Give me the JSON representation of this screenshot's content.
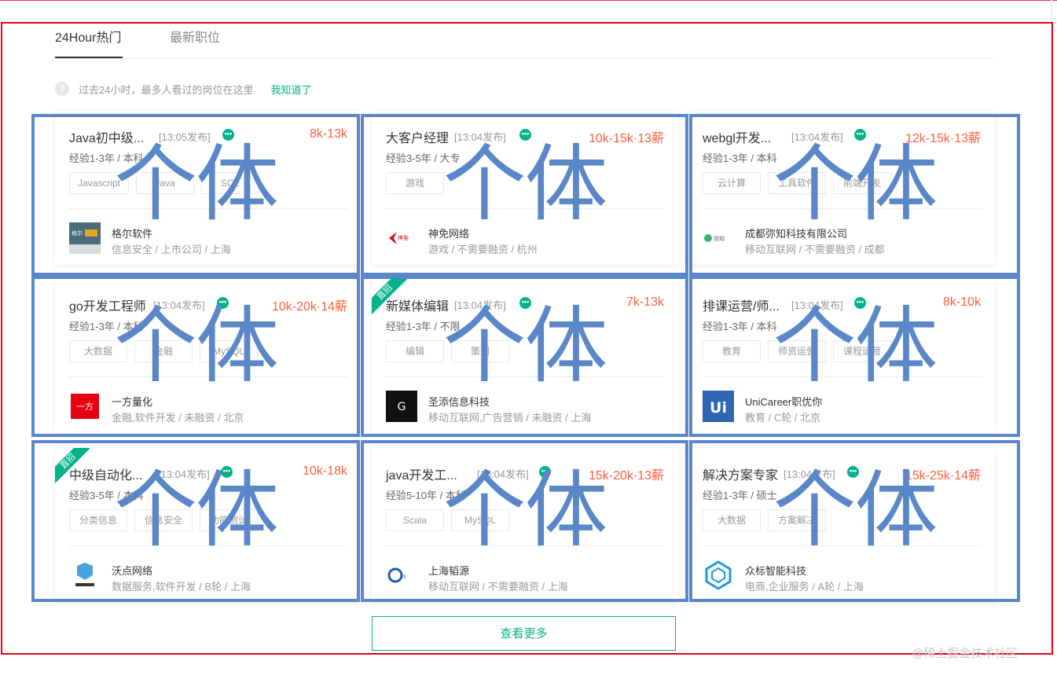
{
  "tabs": [
    {
      "label": "24Hour热门"
    },
    {
      "label": "最新职位"
    }
  ],
  "tip": {
    "icon": "question-icon",
    "text": "过去24小时，最多人看过的岗位在这里",
    "action": "我知道了"
  },
  "jobs": [
    {
      "title": "Java初中级...",
      "published": "[13:05发布]",
      "salary": "8k-13k",
      "requirements": "经验1-3年 / 本科",
      "tags": [
        "Javascript",
        "Java",
        "SQL"
      ],
      "company": "格尔软件",
      "company_info": "信息安全 / 上市公司 / 上海",
      "logo_text": "格尔软件",
      "ribbon": ""
    },
    {
      "title": "大客户经理",
      "published": "[13:04发布]",
      "salary": "10k-15k·13薪",
      "requirements": "经验3-5年 / 大专",
      "tags": [
        "游戏"
      ],
      "company": "神免网络",
      "company_info": "游戏 / 不需要融资 / 杭州",
      "logo_text": "神免网络",
      "ribbon": ""
    },
    {
      "title": "webgl开发...",
      "published": "[13:04发布]",
      "salary": "12k-15k·13薪",
      "requirements": "经验1-3年 / 本科",
      "tags": [
        "云计算",
        "工具软件",
        "前端开发"
      ],
      "company": "成都弥知科技有限公司",
      "company_info": "移动互联网 / 不需要融资 / 成都",
      "logo_text": "弥知科技",
      "ribbon": ""
    },
    {
      "title": "go开发工程师",
      "published": "[13:04发布]",
      "salary": "10k-20k·14薪",
      "requirements": "经验1-3年 / 本科",
      "tags": [
        "大数据",
        "金融",
        "MySQL"
      ],
      "company": "一方量化",
      "company_info": "金融,软件开发 / 未融资 / 北京",
      "logo_text": "一方",
      "ribbon": ""
    },
    {
      "title": "新媒体编辑",
      "published": "[13:04发布]",
      "salary": "7k-13k",
      "requirements": "经验1-3年 / 不限",
      "tags": [
        "编辑",
        "策划"
      ],
      "company": "圣添信息科技",
      "company_info": "移动互联网,广告营销 / 未融资 / 上海",
      "logo_text": "GOOD",
      "ribbon": "直招"
    },
    {
      "title": "排课运营/师...",
      "published": "[13:04发布]",
      "salary": "8k-10k",
      "requirements": "经验1-3年 / 本科",
      "tags": [
        "教育",
        "师资运营",
        "课程运营"
      ],
      "company": "UniCareer职优你",
      "company_info": "教育 / C轮 / 北京",
      "logo_text": "Ui",
      "ribbon": ""
    },
    {
      "title": "中级自动化...",
      "published": "[13:04发布]",
      "salary": "10k-18k",
      "requirements": "经验3-5年 / 本科",
      "tags": [
        "分类信息",
        "信息安全",
        "功能测试"
      ],
      "company": "沃点网络",
      "company_info": "数据服务,软件开发 / B轮 / 上海",
      "logo_text": "沃点网络",
      "ribbon": "直招"
    },
    {
      "title": "java开发工...",
      "published": "[13:04发布]",
      "salary": "15k-20k·13薪",
      "requirements": "经验5-10年 / 本科",
      "tags": [
        "Scala",
        "MySQL"
      ],
      "company": "上海韬源",
      "company_info": "移动互联网 / 不需要融资 / 上海",
      "logo_text": "eSourcing",
      "ribbon": ""
    },
    {
      "title": "解决方案专家",
      "published": "[13:04发布]",
      "salary": "15k-25k·14薪",
      "requirements": "经验1-3年 / 硕士",
      "tags": [
        "大数据",
        "方案解决"
      ],
      "company": "众标智能科技",
      "company_info": "电商,企业服务 / A轮 / 上海",
      "logo_text": "",
      "ribbon": ""
    }
  ],
  "overlay_label": "个体",
  "more_button": "查看更多",
  "watermark": "@稀土掘金技术社区",
  "colors": {
    "accent": "#00b38a",
    "salary": "#fd5f39",
    "frame": "#e60012",
    "overlay": "#5a87c8"
  }
}
